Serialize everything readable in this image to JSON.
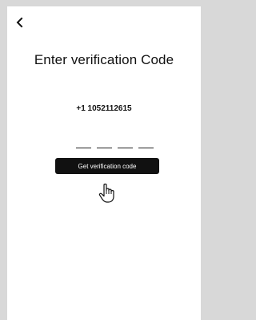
{
  "screen": {
    "back_icon": "chevron-left-icon",
    "title": "Enter verification Code",
    "phone_number": "+1 1052112615",
    "code_length": 4,
    "get_code_label": "Get verification code",
    "cursor_icon": "hand-pointer-icon"
  }
}
